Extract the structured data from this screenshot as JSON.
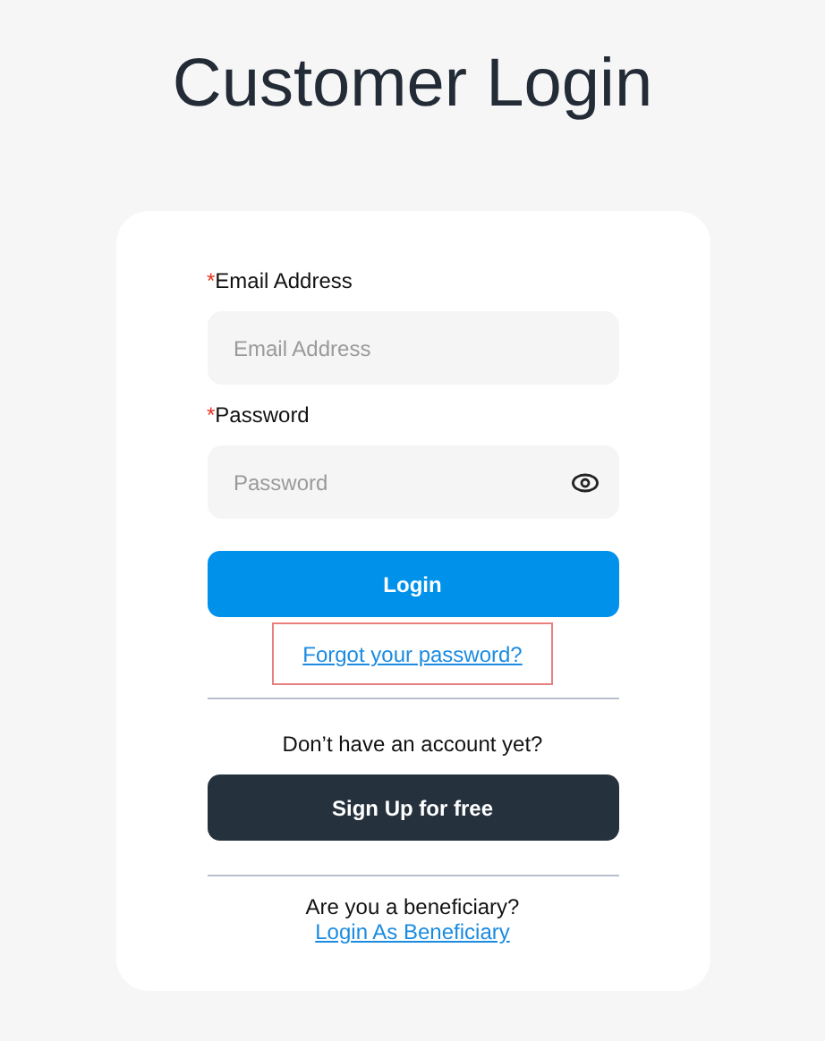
{
  "title": "Customer Login",
  "form": {
    "fields": [
      {
        "kind": "text",
        "required_mark": "*",
        "label": "Email Address",
        "placeholder": "Email Address"
      },
      {
        "kind": "password",
        "required_mark": "*",
        "label": "Password",
        "placeholder": "Password"
      }
    ],
    "login_button": "Login",
    "forgot_link": {
      "label": "Forgot your password?",
      "focused": true
    },
    "signup_prompt": "Don’t have an account yet?",
    "signup_button": "Sign Up for free",
    "beneficiary": {
      "prompt": "Are you a beneficiary?",
      "link": "Login As Beneficiary"
    }
  }
}
